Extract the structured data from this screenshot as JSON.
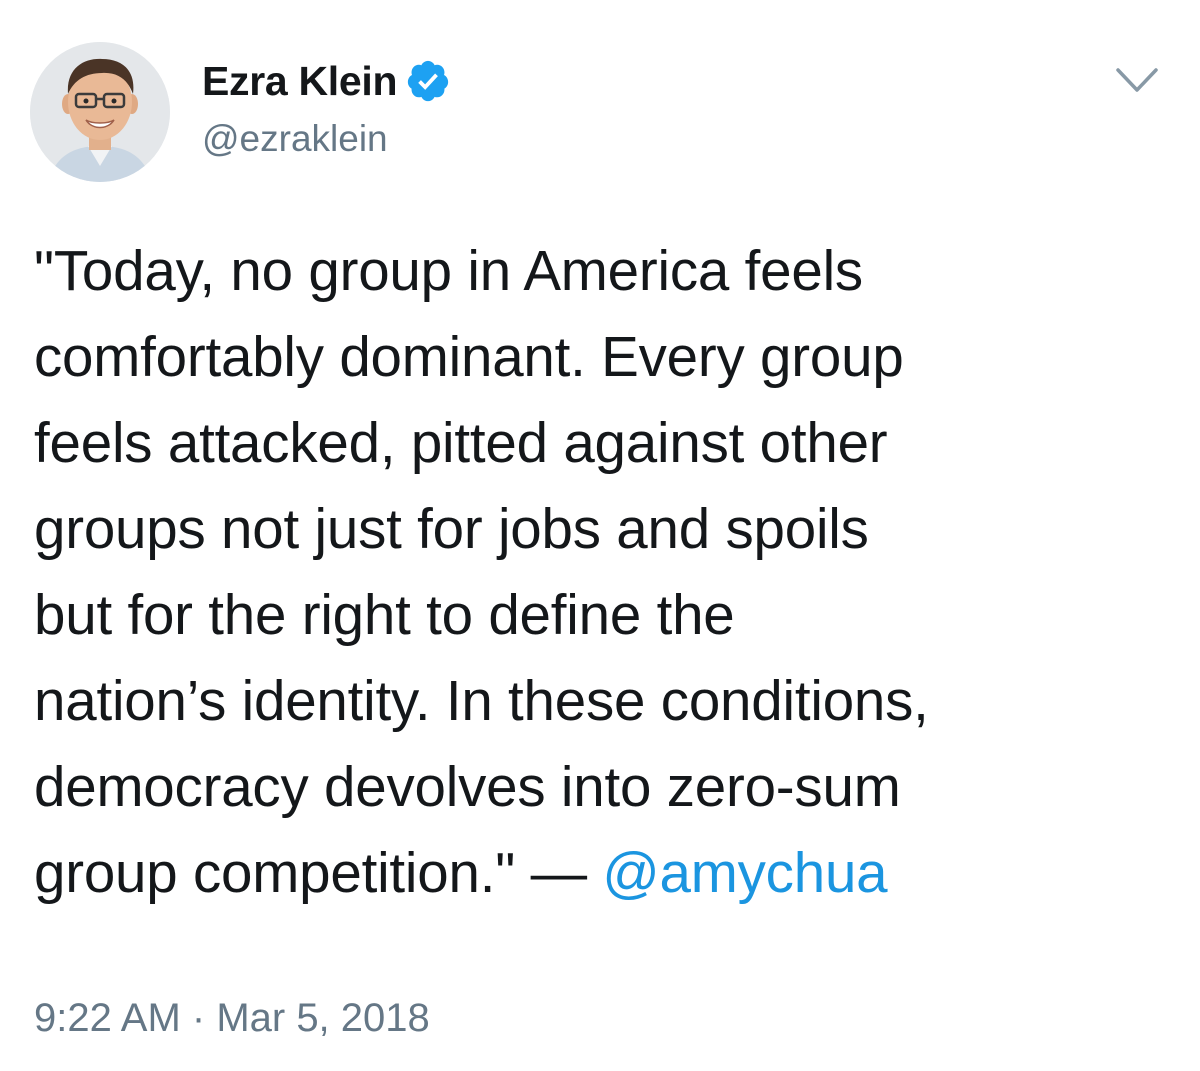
{
  "author": {
    "display_name": "Ezra Klein",
    "handle": "@ezraklein",
    "verified": true,
    "avatar": "profile-photo"
  },
  "menu": {
    "icon": "chevron-down-icon"
  },
  "tweet": {
    "lines": [
      "\"Today, no group in America feels",
      "comfortably dominant. Every group",
      "feels attacked, pitted against other",
      "groups not just for jobs and spoils",
      "but for the right to define the",
      "nation’s identity. In these conditions,",
      "democracy devolves into zero-sum"
    ],
    "last_line_text": "group competition.\" — ",
    "mention": "@amychua"
  },
  "timestamp": {
    "time": "9:22 AM",
    "separator": " · ",
    "date": "Mar 5, 2018"
  },
  "colors": {
    "text": "#14171a",
    "secondary": "#657786",
    "link": "#1b95e0",
    "verified_badge": "#1da1f2"
  }
}
